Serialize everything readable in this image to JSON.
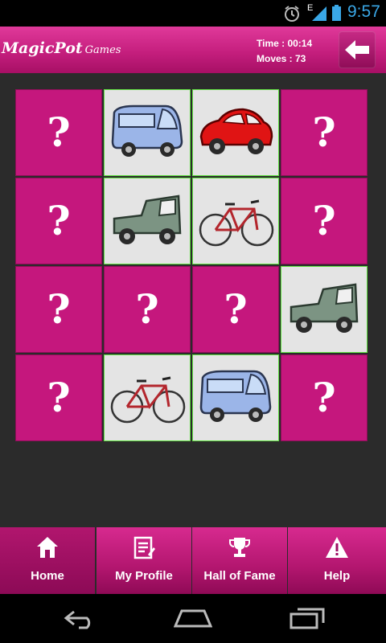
{
  "status_bar": {
    "time": "9:57",
    "network": "E"
  },
  "header": {
    "brand": "MagicPot",
    "brand_sub": "Games",
    "time_text": "Time : 00:14",
    "moves_text": "Moves : 73"
  },
  "board": {
    "hidden_symbol": "?",
    "tiles": [
      "hidden",
      "van",
      "car",
      "hidden",
      "hidden",
      "jeep",
      "bicycle",
      "hidden",
      "hidden",
      "hidden",
      "hidden",
      "jeep",
      "hidden",
      "bicycle",
      "van",
      "hidden"
    ]
  },
  "tabs": [
    {
      "label": "Home",
      "icon": "home-icon",
      "active": true
    },
    {
      "label": "My Profile",
      "icon": "profile-icon",
      "active": false
    },
    {
      "label": "Hall of Fame",
      "icon": "trophy-icon",
      "active": false
    },
    {
      "label": "Help",
      "icon": "warning-icon",
      "active": false
    }
  ],
  "colors": {
    "accent": "#c5177d",
    "revealed_border": "#5ee13f",
    "clock": "#3aa7e6"
  }
}
